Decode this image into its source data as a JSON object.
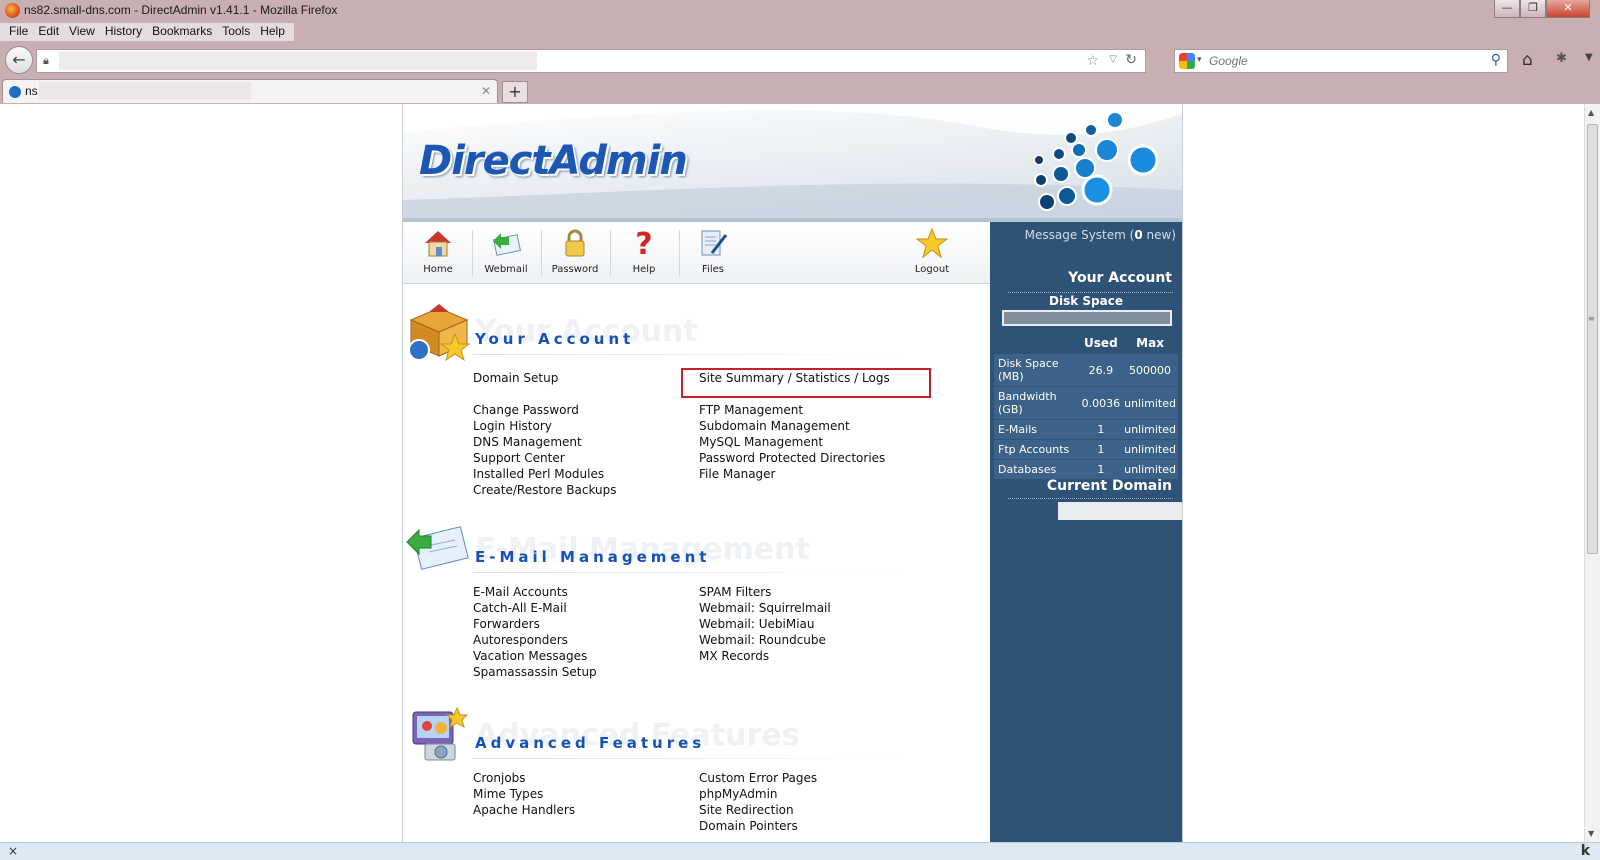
{
  "browser": {
    "window_title": "ns82.small-dns.com - DirectAdmin v1.41.1 - Mozilla Firefox",
    "menu": [
      "File",
      "Edit",
      "View",
      "History",
      "Bookmarks",
      "Tools",
      "Help"
    ],
    "search_placeholder": "Google",
    "tab_title": "ns",
    "status_close": "×",
    "status_right": "k"
  },
  "header": {
    "logo": "DirectAdmin"
  },
  "toolbar": {
    "items": [
      {
        "label": "Home",
        "icon": "home-icon"
      },
      {
        "label": "Webmail",
        "icon": "webmail-icon"
      },
      {
        "label": "Password",
        "icon": "lock-icon"
      },
      {
        "label": "Help",
        "icon": "help-icon"
      },
      {
        "label": "Files",
        "icon": "files-icon"
      },
      {
        "label": "Logout",
        "icon": "star-icon"
      }
    ]
  },
  "sidebar": {
    "message_prefix": "Message System (",
    "message_count": "0",
    "message_suffix": " new)",
    "your_account": "Your Account",
    "disk_space_label": "Disk Space",
    "col_used": "Used",
    "col_max": "Max",
    "rows": [
      {
        "name": "Disk Space (MB)",
        "used": "26.9",
        "max": "500000"
      },
      {
        "name": "Bandwidth (GB)",
        "used": "0.0036",
        "max": "unlimited"
      },
      {
        "name": "E-Mails",
        "used": "1",
        "max": "unlimited"
      },
      {
        "name": "Ftp Accounts",
        "used": "1",
        "max": "unlimited"
      },
      {
        "name": "Databases",
        "used": "1",
        "max": "unlimited"
      }
    ],
    "current_domain": "Current Domain"
  },
  "sections": {
    "account": {
      "title": "Your Account",
      "col1": [
        "Domain Setup",
        "",
        "Change Password",
        "Login History",
        "DNS Management",
        "Support Center",
        "Installed Perl Modules",
        "Create/Restore Backups"
      ],
      "col2": [
        "Site Summary / Statistics / Logs",
        "",
        "FTP Management",
        "Subdomain Management",
        "MySQL Management",
        "Password Protected Directories",
        "File Manager"
      ]
    },
    "email": {
      "title": "E-Mail Management",
      "col1": [
        "E-Mail Accounts",
        "Catch-All E-Mail",
        "Forwarders",
        "Autoresponders",
        "Vacation Messages",
        "Spamassassin Setup"
      ],
      "col2": [
        "SPAM Filters",
        "Webmail: Squirrelmail",
        "Webmail: UebiMiau",
        "Webmail: Roundcube",
        "MX Records"
      ]
    },
    "advanced": {
      "title": "Advanced Features",
      "col1": [
        "Cronjobs",
        "Mime Types",
        "Apache Handlers"
      ],
      "col2": [
        "Custom Error Pages",
        "phpMyAdmin",
        "Site Redirection",
        "Domain Pointers"
      ]
    }
  },
  "colors": {
    "sidebar": "#2f5277",
    "title_blue": "#1552b5",
    "highlight": "#c8202a",
    "chrome": "#c9aeb2"
  }
}
